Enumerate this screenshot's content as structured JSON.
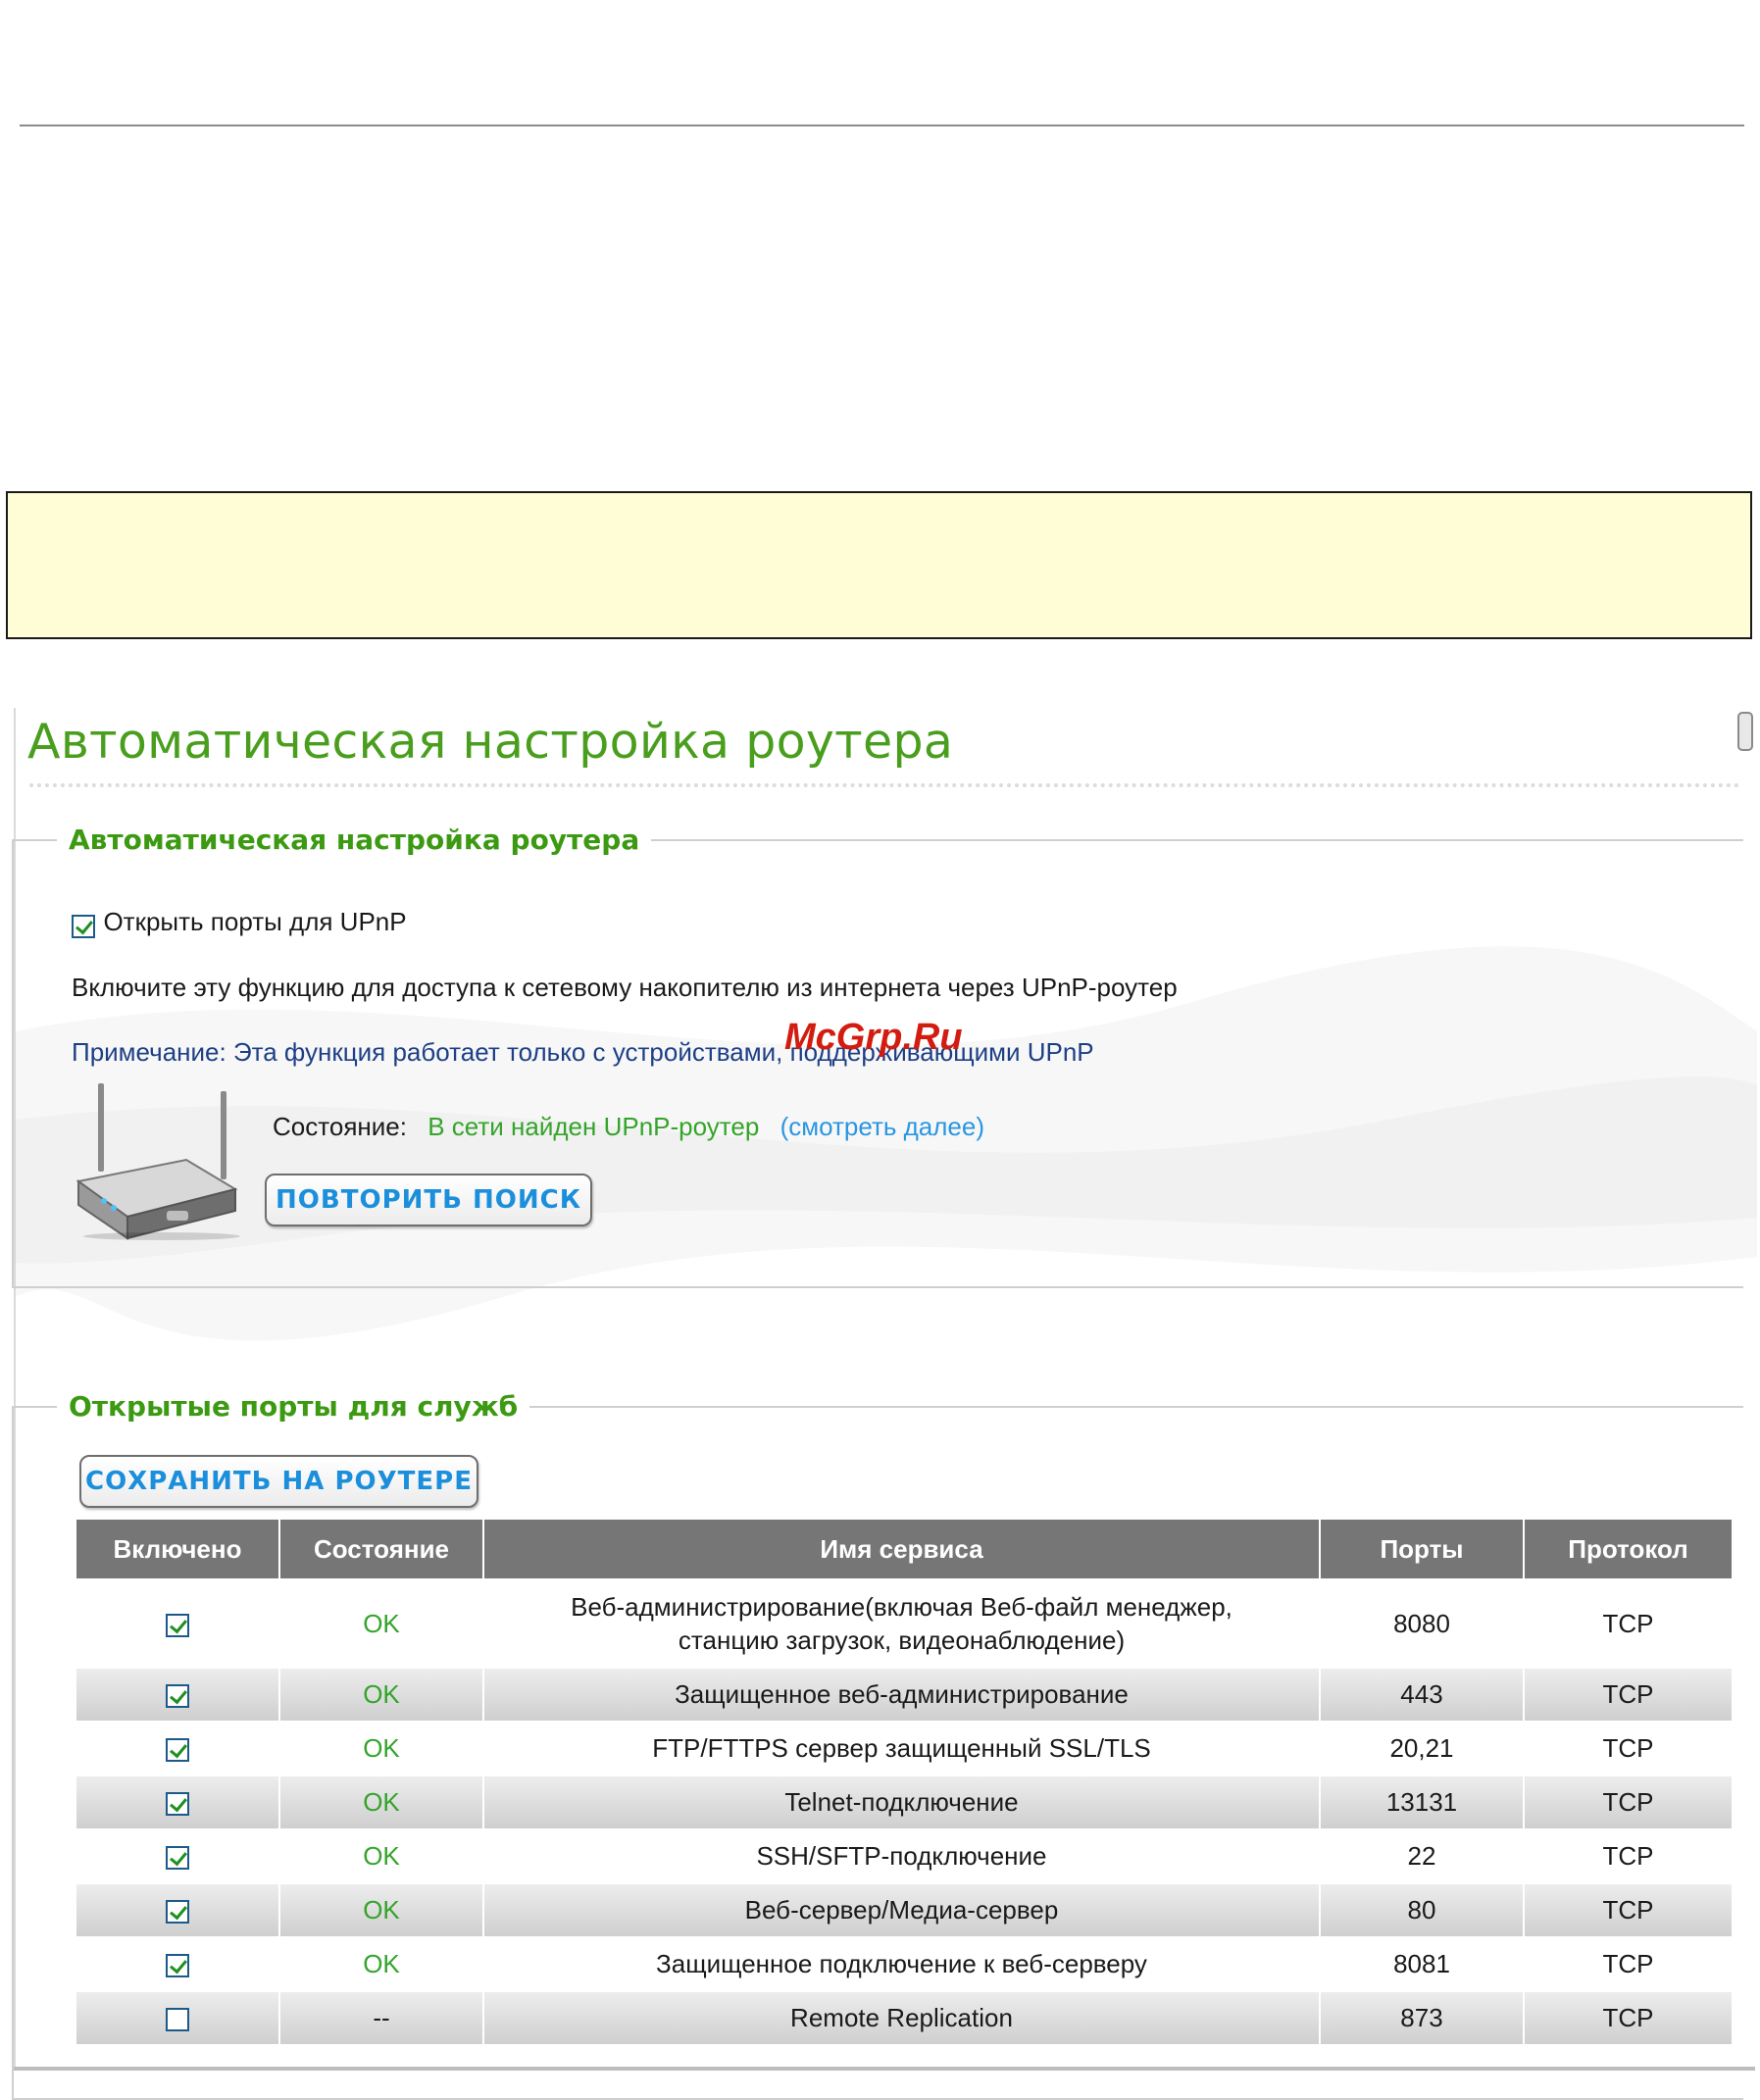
{
  "page_title": "Автоматическая настройка роутера",
  "auto_section": {
    "legend": "Автоматическая настройка роутера",
    "open_ports_checkbox": {
      "label": "Открыть порты для UPnP",
      "checked": true
    },
    "description": "Включите эту функцию для доступа к сетевому накопителю из интернета через UPnP-роутер",
    "note": "Примечание: Эта функция работает только с устройствами, поддерживающими UPnP",
    "status_label": "Состояние:",
    "status_value": "В сети найден UPnP-роутер",
    "status_link": "(смотреть далее)",
    "retry_button": "ПОВТОРИТЬ ПОИСК",
    "icon": "router-icon"
  },
  "watermark": "McGrp.Ru",
  "services_section": {
    "legend": "Открытые порты для служб",
    "save_button": "СОХРАНИТЬ НА РОУТЕРЕ",
    "columns": [
      "Включено",
      "Состояние",
      "Имя сервиса",
      "Порты",
      "Протокол"
    ],
    "rows": [
      {
        "enabled": true,
        "status": "OK",
        "name_line1": "Веб-администрирование(включая Веб-файл менеджер,",
        "name_line2": "станцию загрузок, видеонаблюдение)",
        "ports": "8080",
        "protocol": "TCP"
      },
      {
        "enabled": true,
        "status": "OK",
        "name": "Защищенное веб-администрирование",
        "ports": "443",
        "protocol": "TCP"
      },
      {
        "enabled": true,
        "status": "OK",
        "name": "FTP/FTTPS сервер защищенный SSL/TLS",
        "ports": "20,21",
        "protocol": "TCP"
      },
      {
        "enabled": true,
        "status": "OK",
        "name": "Telnet-подключение",
        "ports": "13131",
        "protocol": "TCP"
      },
      {
        "enabled": true,
        "status": "OK",
        "name": "SSH/SFTP-подключение",
        "ports": "22",
        "protocol": "TCP"
      },
      {
        "enabled": true,
        "status": "OK",
        "name": "Веб-сервер/Медиа-сервер",
        "ports": "80",
        "protocol": "TCP"
      },
      {
        "enabled": true,
        "status": "OK",
        "name": "Защищенное подключение к веб-серверу",
        "ports": "8081",
        "protocol": "TCP"
      },
      {
        "enabled": false,
        "status": "--",
        "name": "Remote Replication",
        "ports": "873",
        "protocol": "TCP"
      }
    ]
  },
  "colors": {
    "accent_green": "#4a9e1e",
    "status_green": "#34a42a",
    "link_blue": "#2a96e0",
    "note_bg": "#fffdd6",
    "table_header": "#767676"
  }
}
